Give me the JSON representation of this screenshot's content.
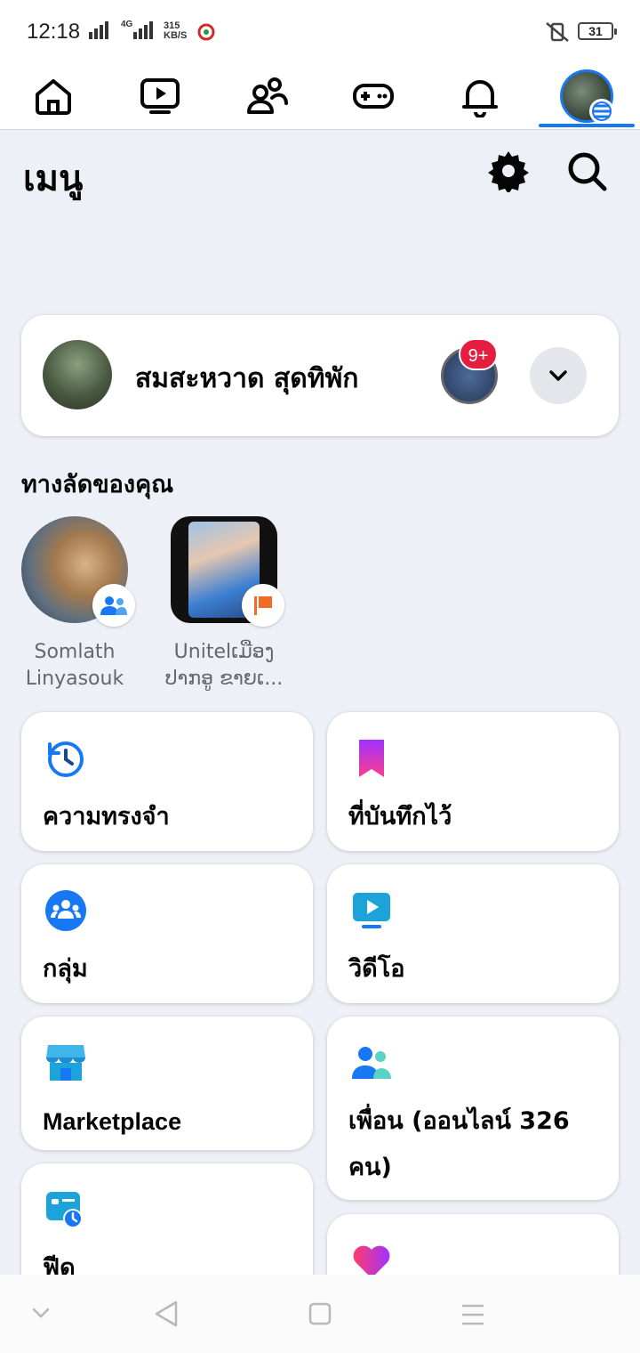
{
  "status_bar": {
    "time": "12:18",
    "network": "4G",
    "speed_value": "315",
    "speed_unit": "KB/S",
    "battery": "31"
  },
  "top_nav": {
    "items": [
      "home-icon",
      "video-icon",
      "friends-icon",
      "gaming-icon",
      "notifications-icon",
      "profile-menu-avatar"
    ],
    "active": "profile-menu-avatar",
    "accent_color": "#1877f2"
  },
  "header": {
    "title": "เมนู",
    "settings_icon": "gear-icon",
    "search_icon": "search-icon"
  },
  "profile": {
    "name": "สมสะหวาด สุดทิพัก",
    "story_badge": "9+"
  },
  "shortcuts": {
    "title": "ทางลัดของคุณ",
    "items": [
      {
        "label": "Somlath Linyasouk",
        "badge": "group-icon"
      },
      {
        "label": "Unitelເມືອງ ປາກອູ ຂາຍເ...",
        "badge": "page-flag-icon"
      }
    ]
  },
  "menu": {
    "memories": "ความทรงจำ",
    "saved": "ที่บันทึกไว้",
    "groups": "กลุ่ม",
    "video": "วิดีโอ",
    "marketplace": "Marketplace",
    "friends": "เพื่อน (ออนไลน์ 326 คน)",
    "feeds": "ฟีด",
    "dating": ""
  },
  "colors": {
    "background": "#edf0f6",
    "card": "#ffffff",
    "notification_red": "#e41e3f",
    "secondary_text": "#65676b"
  }
}
